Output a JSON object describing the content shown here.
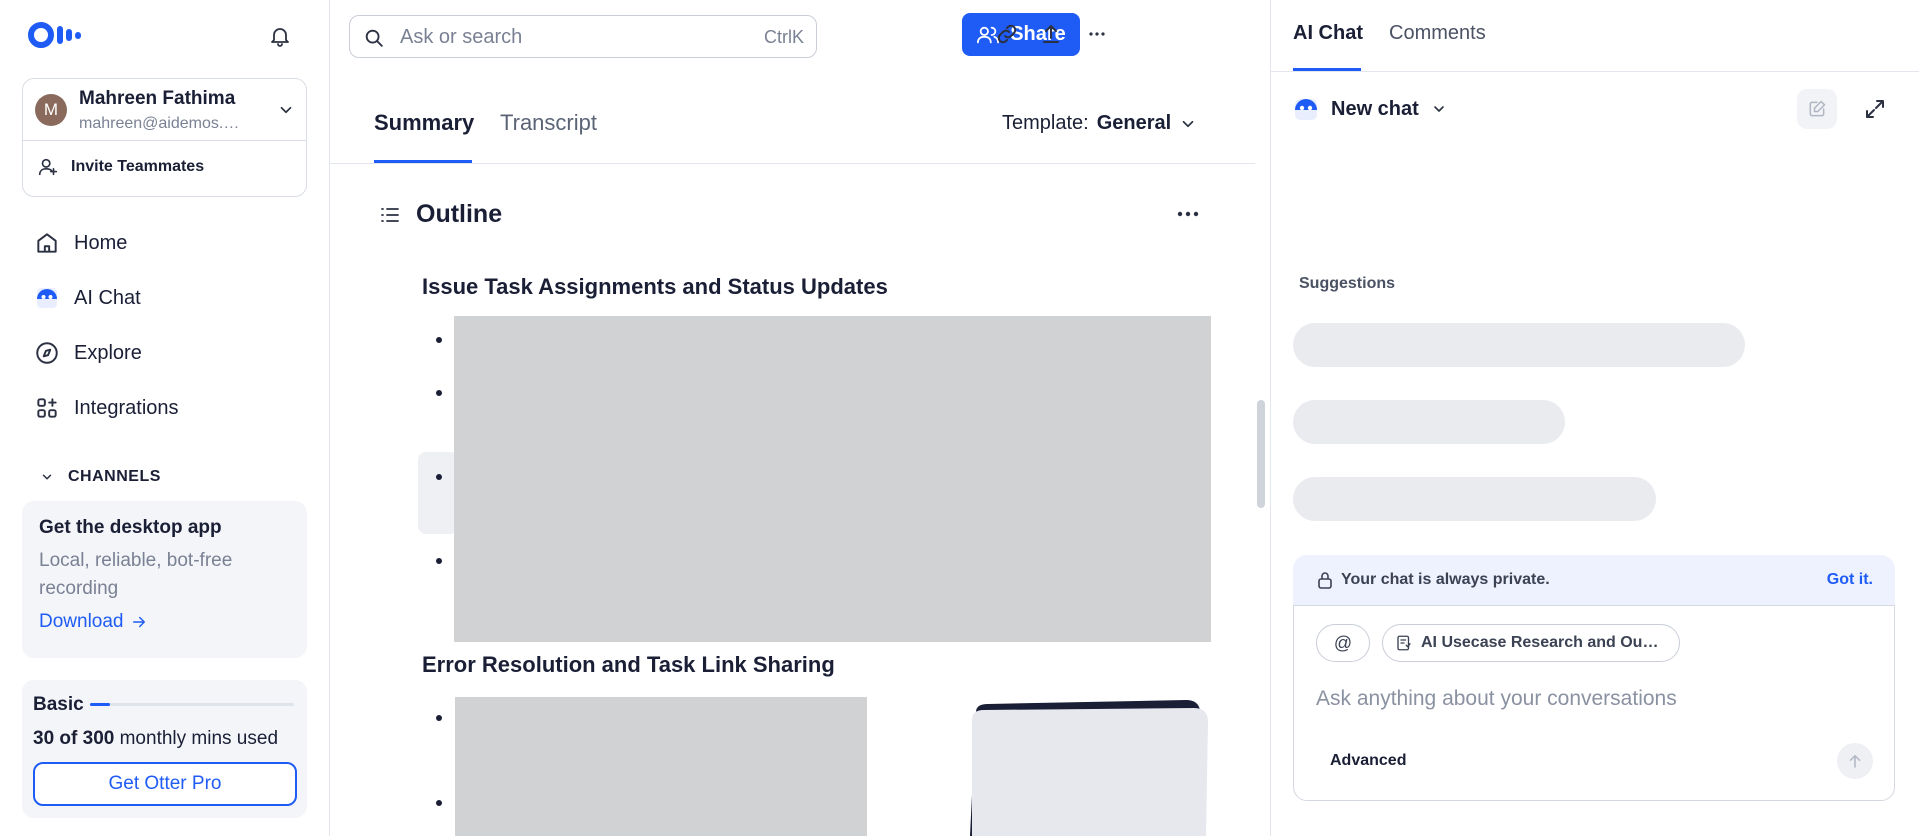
{
  "sidebar": {
    "account": {
      "initial": "M",
      "name": "Mahreen Fathima",
      "email": "mahreen@aidemos.…"
    },
    "invite_label": "Invite Teammates",
    "nav": [
      {
        "label": "Home",
        "icon": "home-icon"
      },
      {
        "label": "AI Chat",
        "icon": "ai-chat-icon"
      },
      {
        "label": "Explore",
        "icon": "compass-icon"
      },
      {
        "label": "Integrations",
        "icon": "integrations-icon"
      }
    ],
    "channels_label": "CHANNELS",
    "desktop_card": {
      "title": "Get the desktop app",
      "description": "Local, reliable, bot-free recording",
      "link": "Download"
    },
    "plan": {
      "name": "Basic",
      "used": "30 of 300",
      "suffix": " monthly mins used",
      "used_fraction": 0.1,
      "cta": "Get Otter Pro"
    }
  },
  "topbar": {
    "search_placeholder": "Ask or search",
    "search_shortcut": "CtrlK",
    "share_label": "Share"
  },
  "main": {
    "tabs": [
      {
        "label": "Summary",
        "active": true
      },
      {
        "label": "Transcript",
        "active": false
      }
    ],
    "template_label": "Template:",
    "template_value": "General",
    "outline_title": "Outline",
    "sections": [
      {
        "title": "Issue Task Assignments and Status Updates"
      },
      {
        "title": "Error Resolution and Task Link Sharing"
      }
    ]
  },
  "right_panel": {
    "tabs": [
      {
        "label": "AI Chat",
        "active": true
      },
      {
        "label": "Comments",
        "active": false
      }
    ],
    "new_chat_label": "New chat",
    "suggestions_label": "Suggestions",
    "privacy_text": "Your chat is always private.",
    "privacy_dismiss": "Got it.",
    "at_chip": "@",
    "context_chip": "AI Usecase Research and Ou…",
    "input_placeholder": "Ask anything about your conversations",
    "advanced_label": "Advanced"
  },
  "colors": {
    "accent": "#1f5cf5",
    "placeholder_gray": "#d1d2d4",
    "panel_bg": "#f3f5f8"
  }
}
